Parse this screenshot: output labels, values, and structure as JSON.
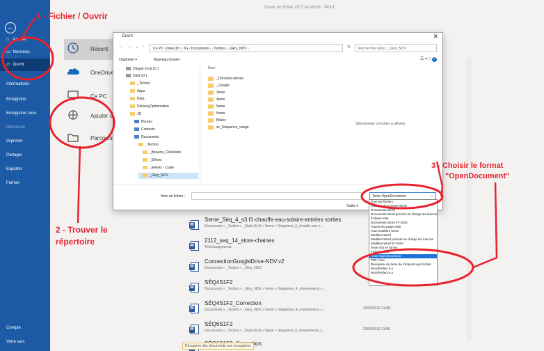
{
  "window": {
    "title": "Ouvrir un fichier ODT en Word - Word"
  },
  "sidebar": {
    "items": [
      {
        "label": "Accueil",
        "icon": "home-icon"
      },
      {
        "label": "Nouveau",
        "icon": "new-icon"
      },
      {
        "label": "Ouvrir",
        "icon": "open-folder-icon"
      },
      {
        "label": "Informations"
      },
      {
        "label": "Enregistrer"
      },
      {
        "label": "Enregistrer sous"
      },
      {
        "label": "Historique"
      },
      {
        "label": "Imprimer"
      },
      {
        "label": "Partager"
      },
      {
        "label": "Exporter"
      },
      {
        "label": "Fermer"
      }
    ],
    "bottom": [
      {
        "label": "Compte"
      },
      {
        "label": "Votre avis"
      }
    ]
  },
  "open_nav": {
    "items": [
      {
        "label": "Récent"
      },
      {
        "label": "OneDrive"
      },
      {
        "label": "Ce PC"
      },
      {
        "label": "Ajouter un em"
      },
      {
        "label": "Parcourir"
      }
    ]
  },
  "recent": {
    "items": [
      {
        "name": "Seme_Séq_4_s3.f1-chauffe-eau-solaire-entrées sorties",
        "path": "Documents » _Techno » _Nuits-St-G » 5eme » Séquence_6_chauffe eau s...",
        "date": ""
      },
      {
        "name": "2112_seq_14_store-chaines",
        "path": "Téléchargements",
        "date": ""
      },
      {
        "name": "ConnectionGoogleDrive-NDV.v2",
        "path": "Documents » _Techno » _Gkry_NDV",
        "date": ""
      },
      {
        "name": "SÉQ4S1F2",
        "path": "Documents » _Techno » _Gkry_NDV » 6eme » Séquence_4_mouvements »...",
        "date": ""
      },
      {
        "name": "SÉQ4S1F2_Correction",
        "path": "Documents » _Techno » _Gkry_NDV » 6eme » Séquence_4_mouvements »...",
        "date": "23/03/2020 11:08"
      },
      {
        "name": "SÉQ6S1F2",
        "path": "Documents » _Techno » _Nuits-St-G » 5eme » Séquence_6_mouvements »...",
        "date": "23/03/2020 11:06"
      },
      {
        "name": "SÉQ6S1F2_Correction",
        "path": "",
        "date": ""
      }
    ],
    "more_link": "Récupérer des documents non enregistrés"
  },
  "dialog": {
    "title": "Ouvrir",
    "address": "Ce PC › Data (D:) › JG › Documents › _Techno › _Gkry_NDV ›",
    "search_placeholder": "Rechercher dans : _Gkry_NDV",
    "organize": "Organiser ▾",
    "new_folder": "Nouveau dossier",
    "tree": [
      {
        "label": "Disque local (C:)",
        "kind": "drive"
      },
      {
        "label": "Data (D:)",
        "kind": "drive"
      },
      {
        "label": "_Techno",
        "kind": "folder"
      },
      {
        "label": "Apps",
        "kind": "folder"
      },
      {
        "label": "Data",
        "kind": "folder"
      },
      {
        "label": "DeliveryOptimization",
        "kind": "folder"
      },
      {
        "label": "JG",
        "kind": "folder"
      },
      {
        "label": "Bureau",
        "kind": "folder"
      },
      {
        "label": "Contacts",
        "kind": "folder"
      },
      {
        "label": "Documents",
        "kind": "folder"
      },
      {
        "label": "_Techno",
        "kind": "folder"
      },
      {
        "label": "_Beaune_ClosMaire",
        "kind": "folder"
      },
      {
        "label": "_Elèves",
        "kind": "folder"
      },
      {
        "label": "_Elèves - Copie",
        "kind": "folder"
      },
      {
        "label": "_Gkry_NDV",
        "kind": "folder",
        "selected": true
      }
    ],
    "list_header": "Nom",
    "files": [
      "_Données-élèves",
      "_Google",
      "3eme",
      "4eme",
      "5eme",
      "6eme",
      "Bilans",
      "zz_Séquence_vierge"
    ],
    "preview_text": "Sélectionner un fichier à afficher.",
    "filename_label": "Nom de fichier :",
    "filename_value": "",
    "type_value": "Texte OpenDocument",
    "tools_label": "Outils ▾"
  },
  "dropdown": {
    "options": [
      "Tous les fichiers",
      "Tous les documents Word",
      "Documents Word",
      "Documents Word prenant en charge les macros",
      "Fichiers XML",
      "Documents Word 97-2003",
      "Toutes les pages web",
      "Tous modèles Word",
      "Modèles Word",
      "Modèles Word prenant en charge les macros",
      "Modèles Word 97-2003",
      "Texte mis en forme",
      "Fichiers texte",
      "Texte OpenDocument",
      "PDF Files",
      "Récupérer du texte de n'importe quel fichier",
      "WordPerfect 5.x",
      "WordPerfect 6.x"
    ],
    "selected_index": 13
  },
  "annotations": {
    "step1": "1 - Fichier / Ouvrir",
    "step2_line1": "2 - Trouver le",
    "step2_line2": "répertoire",
    "step3_line1": "3 - Choisir le format",
    "step3_line2": "\"OpenDocument\"",
    "color": "#e8212d"
  }
}
